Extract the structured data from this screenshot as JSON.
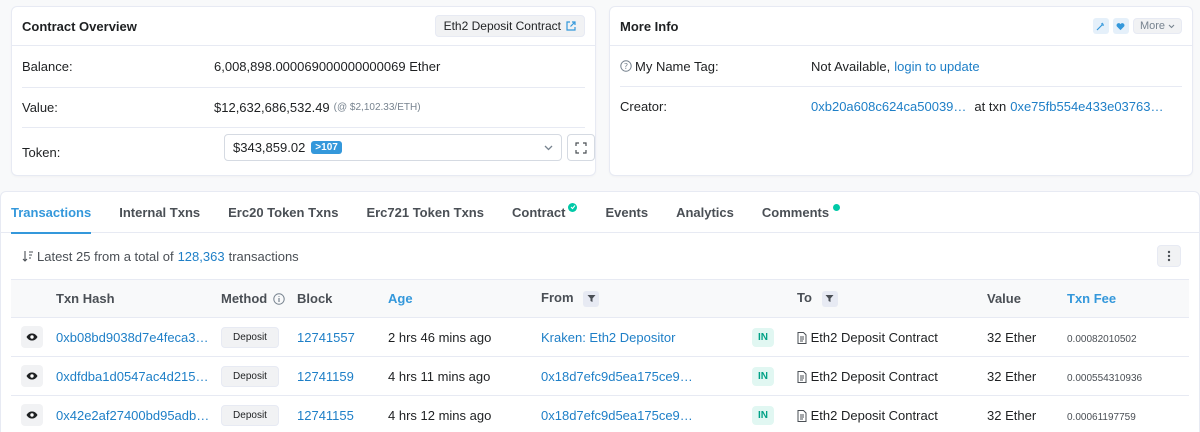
{
  "overview": {
    "title": "Contract Overview",
    "contract_tag": "Eth2 Deposit Contract",
    "balance_label": "Balance:",
    "balance_value": "6,008,898.000069000000000069 Ether",
    "value_label": "Value:",
    "value_amount": "$12,632,686,532.49",
    "value_rate": "(@ $2,102.33/ETH)",
    "token_label": "Token:",
    "token_value": "$343,859.02",
    "token_count": ">107"
  },
  "more_info": {
    "title": "More Info",
    "more_button": "More",
    "name_tag_label": "My Name Tag:",
    "name_tag_value": "Not Available,",
    "name_tag_link": "login to update",
    "creator_label": "Creator:",
    "creator_address": "0xb20a608c624ca50039…",
    "creator_at": "at txn",
    "creator_txn": "0xe75fb554e433e03763…"
  },
  "tabs": [
    {
      "label": "Transactions",
      "active": true
    },
    {
      "label": "Internal Txns"
    },
    {
      "label": "Erc20 Token Txns"
    },
    {
      "label": "Erc721 Token Txns"
    },
    {
      "label": "Contract"
    },
    {
      "label": "Events"
    },
    {
      "label": "Analytics"
    },
    {
      "label": "Comments"
    }
  ],
  "summary": {
    "prefix": "Latest 25 from a total of",
    "count": "128,363",
    "suffix": "transactions"
  },
  "table": {
    "headers": [
      "Txn Hash",
      "Method",
      "Block",
      "Age",
      "From",
      "To",
      "Value",
      "Txn Fee"
    ],
    "rows": [
      {
        "hash": "0xb08bd9038d7e4feca3…",
        "method": "Deposit",
        "block": "12741557",
        "age": "2 hrs 46 mins ago",
        "from": "Kraken: Eth2 Depositor",
        "direction": "IN",
        "to": "Eth2 Deposit Contract",
        "value": "32 Ether",
        "fee": "0.00082010502"
      },
      {
        "hash": "0xdfdba1d0547ac4d215…",
        "method": "Deposit",
        "block": "12741159",
        "age": "4 hrs 11 mins ago",
        "from": "0x18d7efc9d5ea175ce9…",
        "direction": "IN",
        "to": "Eth2 Deposit Contract",
        "value": "32 Ether",
        "fee": "0.000554310936"
      },
      {
        "hash": "0x42e2af27400bd95adb…",
        "method": "Deposit",
        "block": "12741155",
        "age": "4 hrs 12 mins ago",
        "from": "0x18d7efc9d5ea175ce9…",
        "direction": "IN",
        "to": "Eth2 Deposit Contract",
        "value": "32 Ether",
        "fee": "0.00061197759"
      }
    ]
  },
  "colors": {
    "link": "#1e7fc7",
    "accent": "#3498db",
    "success": "#00c9a7"
  }
}
